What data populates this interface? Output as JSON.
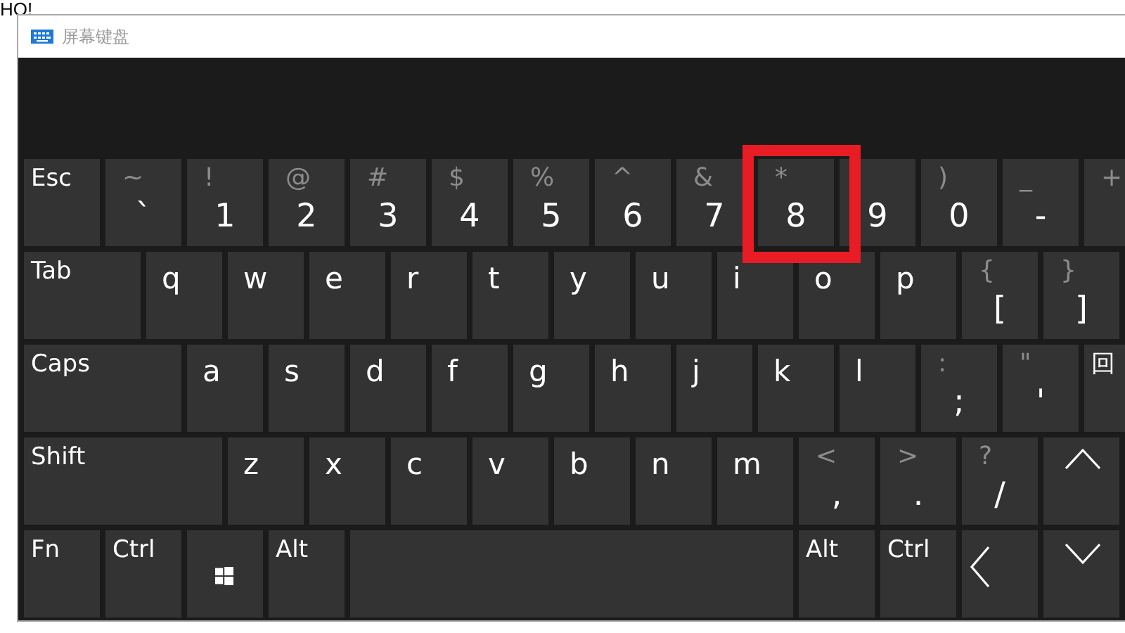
{
  "background": {
    "text": "HO!"
  },
  "window": {
    "title": "屏幕键盘"
  },
  "rows": [
    [
      {
        "kind": "mod",
        "label": "Esc",
        "highlighted": false
      },
      {
        "kind": "symbol",
        "shift": "~",
        "label": "`",
        "highlighted": false
      },
      {
        "kind": "symbol",
        "shift": "!",
        "label": "1",
        "highlighted": false
      },
      {
        "kind": "symbol",
        "shift": "@",
        "label": "2",
        "highlighted": false
      },
      {
        "kind": "symbol",
        "shift": "#",
        "label": "3",
        "highlighted": false
      },
      {
        "kind": "symbol",
        "shift": "$",
        "label": "4",
        "highlighted": false
      },
      {
        "kind": "symbol",
        "shift": "%",
        "label": "5",
        "highlighted": false
      },
      {
        "kind": "symbol",
        "shift": "^",
        "label": "6",
        "highlighted": false
      },
      {
        "kind": "symbol",
        "shift": "&",
        "label": "7",
        "highlighted": false
      },
      {
        "kind": "symbol",
        "shift": "*",
        "label": "8",
        "highlighted": true
      },
      {
        "kind": "symbol",
        "label": "9",
        "highlighted": false
      },
      {
        "kind": "symbol",
        "shift": ")",
        "label": "0",
        "highlighted": false
      },
      {
        "kind": "symbol",
        "shift": "_",
        "label": "-",
        "highlighted": false
      },
      {
        "kind": "symbol",
        "shift": "+",
        "highlighted": false
      }
    ],
    [
      {
        "kind": "tab",
        "label": "Tab",
        "highlighted": false
      },
      {
        "kind": "letter",
        "label": "q",
        "highlighted": false
      },
      {
        "kind": "letter",
        "label": "w",
        "highlighted": false
      },
      {
        "kind": "letter",
        "label": "e",
        "highlighted": false
      },
      {
        "kind": "letter",
        "label": "r",
        "highlighted": false
      },
      {
        "kind": "letter",
        "label": "t",
        "highlighted": false
      },
      {
        "kind": "letter",
        "label": "y",
        "highlighted": false
      },
      {
        "kind": "letter",
        "label": "u",
        "highlighted": false
      },
      {
        "kind": "letter",
        "label": "i",
        "highlighted": false
      },
      {
        "kind": "letter",
        "label": "o",
        "highlighted": false
      },
      {
        "kind": "letter",
        "label": "p",
        "highlighted": false
      },
      {
        "kind": "symbol",
        "shift": "{",
        "label": "[",
        "highlighted": false
      },
      {
        "kind": "symbol",
        "shift": "}",
        "label": "]",
        "highlighted": false
      }
    ],
    [
      {
        "kind": "caps",
        "label": "Caps",
        "highlighted": false
      },
      {
        "kind": "letter",
        "label": "a",
        "highlighted": false
      },
      {
        "kind": "letter",
        "label": "s",
        "highlighted": false
      },
      {
        "kind": "letter",
        "label": "d",
        "highlighted": false
      },
      {
        "kind": "letter",
        "label": "f",
        "highlighted": false
      },
      {
        "kind": "letter",
        "label": "g",
        "highlighted": false
      },
      {
        "kind": "letter",
        "label": "h",
        "highlighted": false
      },
      {
        "kind": "letter",
        "label": "j",
        "highlighted": false
      },
      {
        "kind": "letter",
        "label": "k",
        "highlighted": false
      },
      {
        "kind": "letter",
        "label": "l",
        "highlighted": false
      },
      {
        "kind": "symbol",
        "shift": ":",
        "label": ";",
        "highlighted": false
      },
      {
        "kind": "symbol",
        "shift": "\"",
        "label": "'",
        "highlighted": false
      },
      {
        "kind": "mod",
        "label": "回",
        "highlighted": false
      }
    ],
    [
      {
        "kind": "shift",
        "label": "Shift",
        "highlighted": false
      },
      {
        "kind": "letter",
        "label": "z",
        "highlighted": false
      },
      {
        "kind": "letter",
        "label": "x",
        "highlighted": false
      },
      {
        "kind": "letter",
        "label": "c",
        "highlighted": false
      },
      {
        "kind": "letter",
        "label": "v",
        "highlighted": false
      },
      {
        "kind": "letter",
        "label": "b",
        "highlighted": false
      },
      {
        "kind": "letter",
        "label": "n",
        "highlighted": false
      },
      {
        "kind": "letter",
        "label": "m",
        "highlighted": false
      },
      {
        "kind": "symbol",
        "shift": "<",
        "label": ",",
        "highlighted": false
      },
      {
        "kind": "symbol",
        "shift": ">",
        "label": ".",
        "highlighted": false
      },
      {
        "kind": "symbol",
        "shift": "?",
        "label": "/",
        "highlighted": false
      },
      {
        "kind": "arrow-up",
        "highlighted": false
      }
    ],
    [
      {
        "kind": "mod",
        "label": "Fn",
        "highlighted": false
      },
      {
        "kind": "mod",
        "label": "Ctrl",
        "highlighted": false
      },
      {
        "kind": "win",
        "highlighted": false
      },
      {
        "kind": "mod",
        "label": "Alt",
        "highlighted": false
      },
      {
        "kind": "space",
        "highlighted": false
      },
      {
        "kind": "mod",
        "label": "Alt",
        "highlighted": false
      },
      {
        "kind": "mod",
        "label": "Ctrl",
        "highlighted": false
      },
      {
        "kind": "arrow-left",
        "highlighted": false
      },
      {
        "kind": "arrow-down",
        "highlighted": false
      }
    ]
  ]
}
